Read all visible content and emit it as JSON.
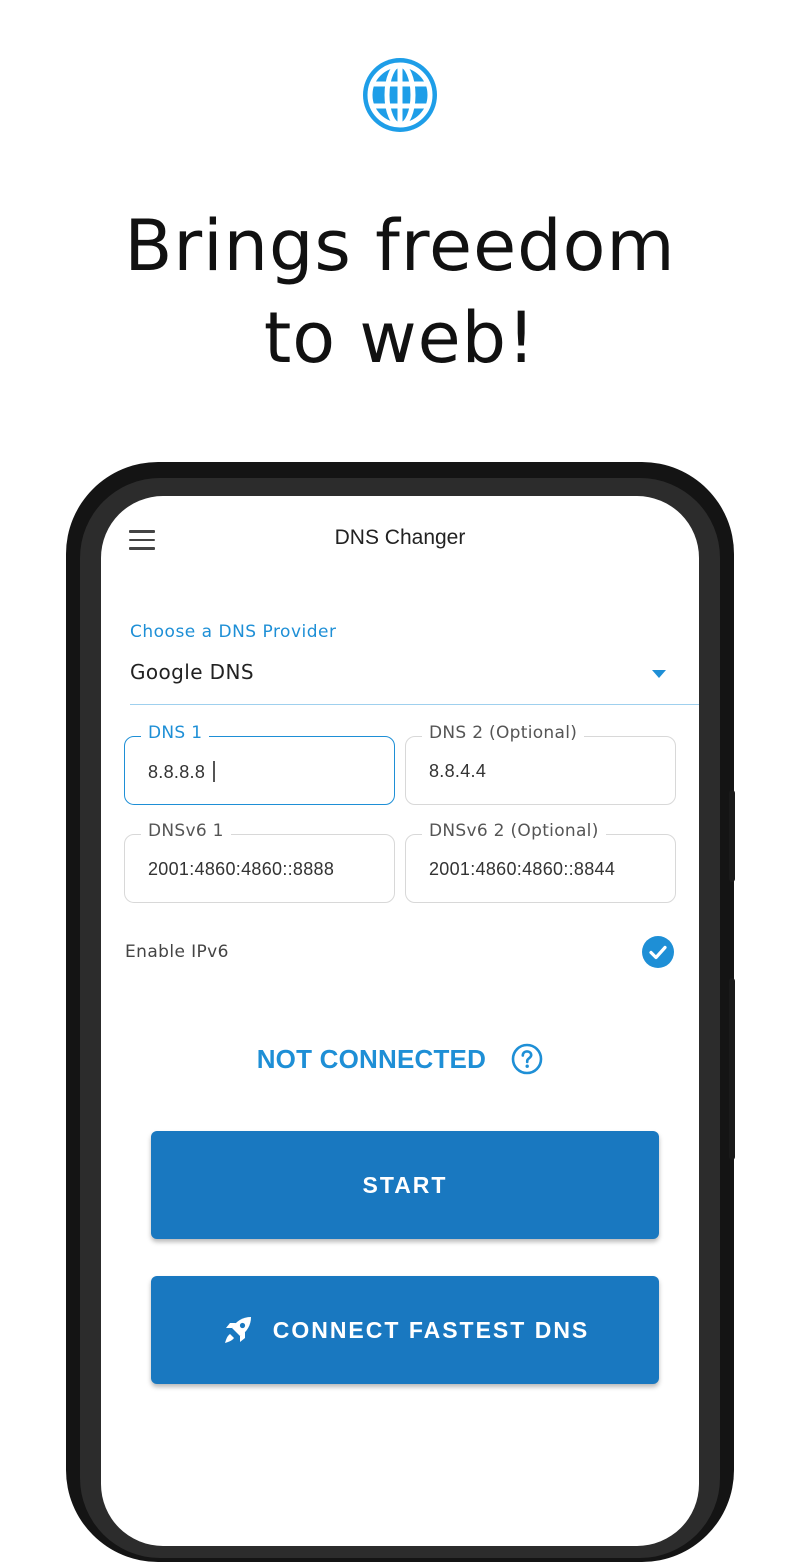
{
  "promo": {
    "headline_line1": "Brings freedom",
    "headline_line2": "to web!",
    "icon": "globe-icon",
    "accent_color": "#1e9ee8"
  },
  "app": {
    "title": "DNS Changer",
    "menu_icon": "hamburger-menu-icon"
  },
  "provider": {
    "label": "Choose a DNS Provider",
    "selected": "Google DNS"
  },
  "fields": {
    "dns1": {
      "label": "DNS 1",
      "value": "8.8.8.8"
    },
    "dns2": {
      "label": "DNS 2 (Optional)",
      "value": "8.8.4.4"
    },
    "dnsv6_1": {
      "label": "DNSv6 1",
      "value": "2001:4860:4860::8888"
    },
    "dnsv6_2": {
      "label": "DNSv6 2 (Optional)",
      "value": "2001:4860:4860::8844"
    }
  },
  "ipv6": {
    "label": "Enable IPv6",
    "checked": true
  },
  "status": {
    "text": "NOT CONNECTED",
    "color": "#1e8fd6"
  },
  "buttons": {
    "start_label": "START",
    "fastest_label": "CONNECT FASTEST DNS",
    "button_color": "#1978c0"
  }
}
